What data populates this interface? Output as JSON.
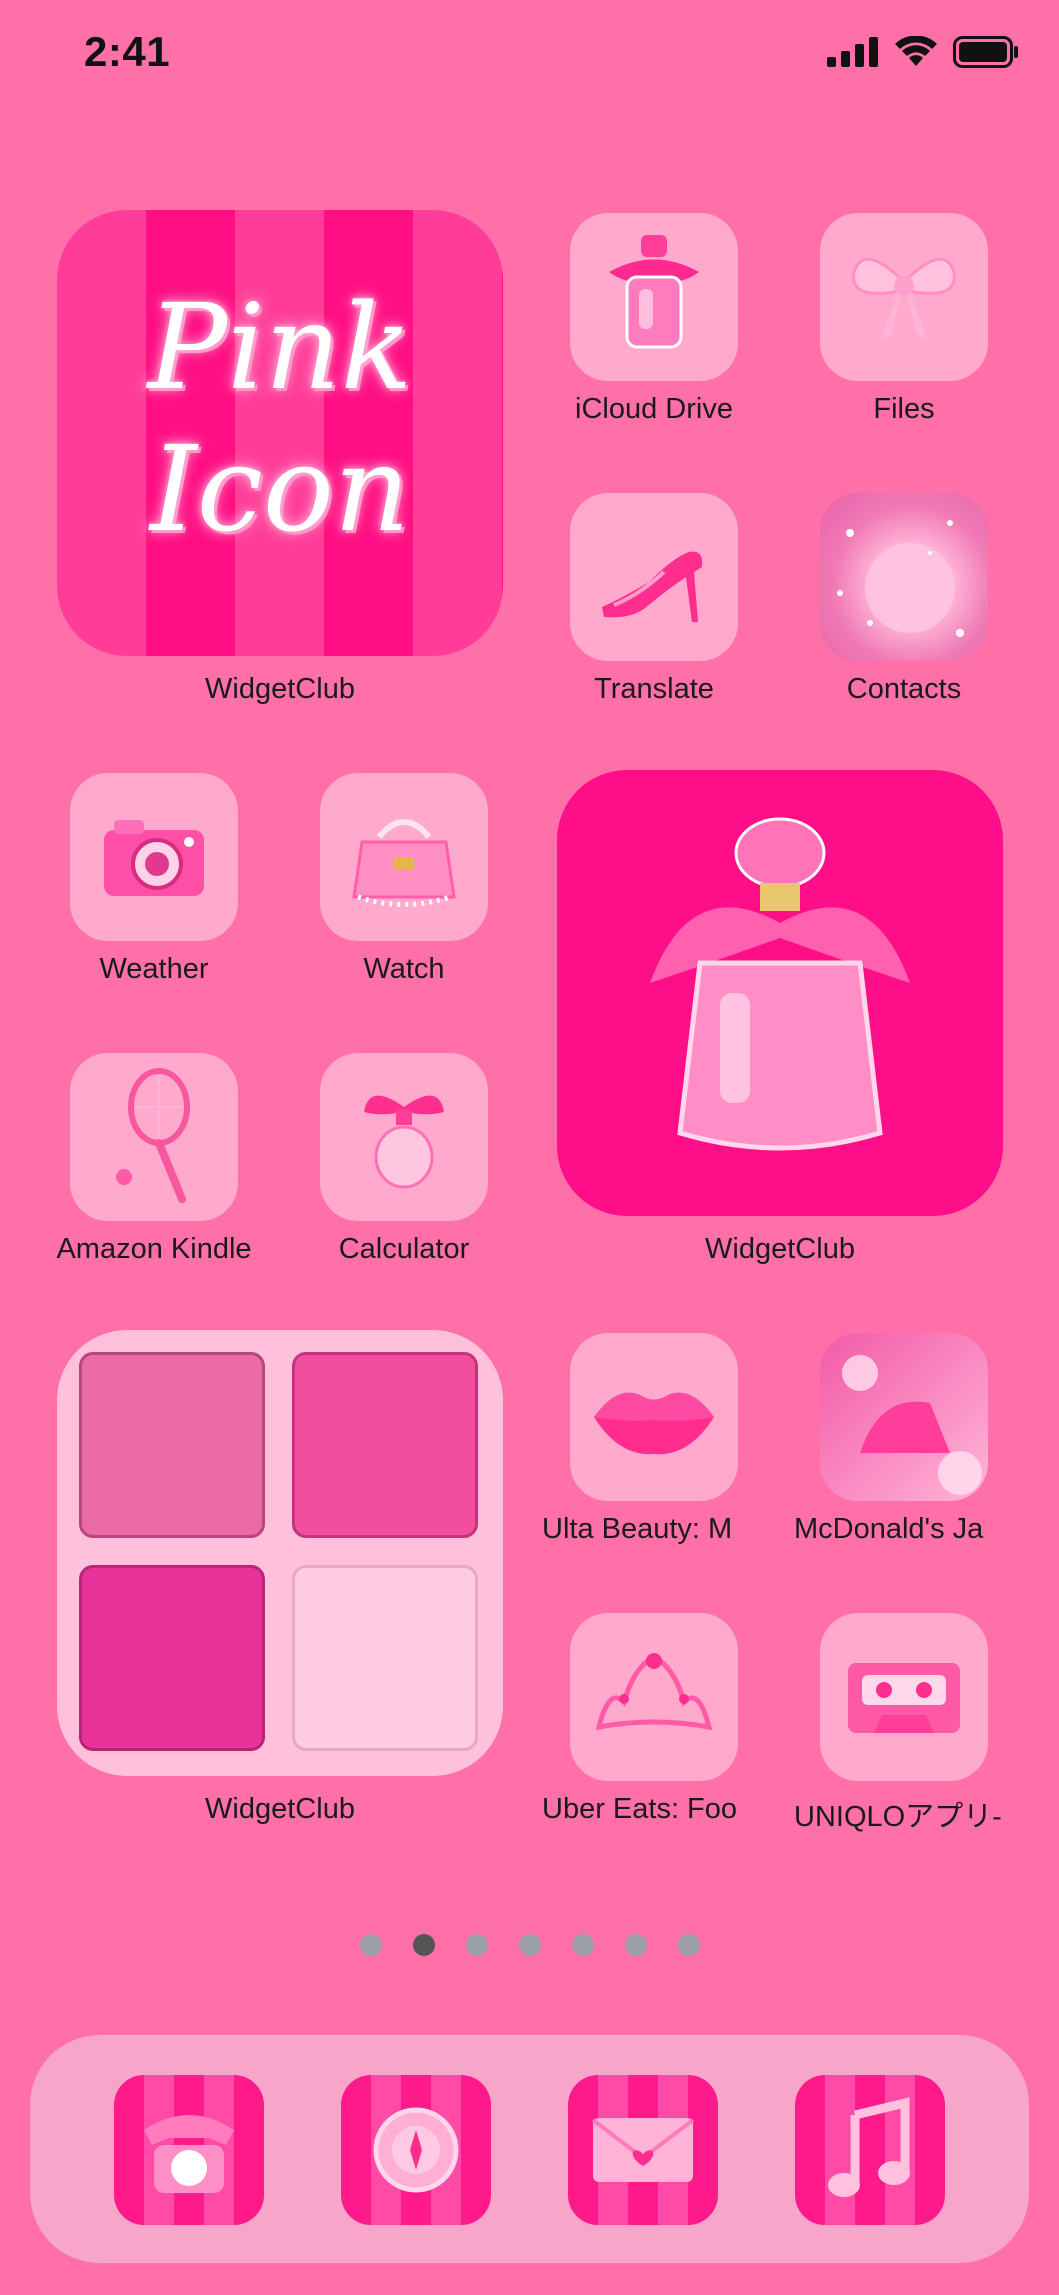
{
  "status": {
    "time": "2:41"
  },
  "widgets": {
    "pink_icon": {
      "line1": "Pink",
      "line2": "Icon",
      "label": "WidgetClub"
    },
    "perfume": {
      "label": "WidgetClub"
    },
    "palette": {
      "label": "WidgetClub"
    }
  },
  "apps": {
    "icloud_drive": "iCloud Drive",
    "files": "Files",
    "translate": "Translate",
    "contacts": "Contacts",
    "weather": "Weather",
    "watch": "Watch",
    "amazon_kindle": "Amazon Kindle",
    "calculator": "Calculator",
    "ulta_beauty": "Ulta Beauty: M",
    "mcdonalds": "McDonald's Ja",
    "uber_eats": "Uber Eats: Foo",
    "uniqlo": "UNIQLOアプリ-"
  },
  "page_indicator": {
    "count": 7,
    "active_index": 1
  },
  "dock": {
    "icons": [
      "telephone-icon",
      "compass-icon",
      "envelope-icon",
      "music-note-icon"
    ]
  }
}
